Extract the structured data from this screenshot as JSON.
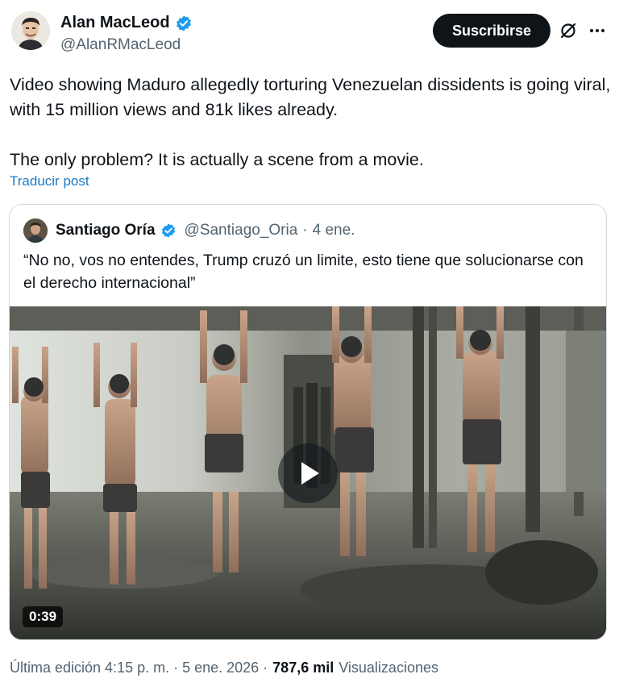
{
  "author": {
    "display_name": "Alan MacLeod",
    "handle": "@AlanRMacLeod",
    "verified": true
  },
  "actions": {
    "subscribe_label": "Suscribirse",
    "grok_icon": "grok-slash-circle-icon",
    "more_icon": "more-horizontal-icon"
  },
  "tweet": {
    "paragraph_1": "Video showing Maduro allegedly torturing Venezuelan dissidents is going viral, with 15 million views and 81k likes already.",
    "paragraph_2": "The only problem? It is actually a scene from a movie.",
    "translate_label": "Traducir post"
  },
  "quoted": {
    "display_name": "Santiago Oría",
    "handle": "@Santiago_Oria",
    "separator": "·",
    "date": "4 ene.",
    "verified": true,
    "text": "“No no, vos no entendes, Trump cruzó un limite, esto tiene que solucionarse con el derecho internacional”",
    "video": {
      "duration": "0:39",
      "play_icon": "play-icon"
    }
  },
  "footer": {
    "edit_label": "Última edición 4:15 p. m. · 5 ene. 2026 ·",
    "views_count": "787,6 mil",
    "views_label": "Visualizaciones"
  },
  "colors": {
    "text_primary": "#0f1419",
    "text_secondary": "#536471",
    "link": "#1d7bc4",
    "verified_badge": "#1d9bf0",
    "button_bg": "#0f1419",
    "border": "#cfd9de"
  }
}
